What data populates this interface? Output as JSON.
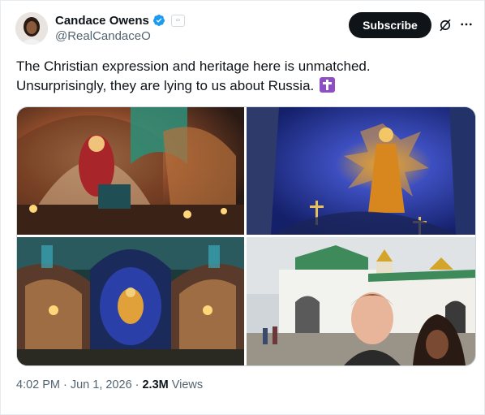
{
  "author": {
    "name": "Candace Owens",
    "handle": "@RealCandaceO",
    "verified_color": "#1d9bf0"
  },
  "header": {
    "subscribe_label": "Subscribe",
    "grok_icon": "grok-icon",
    "more_icon": "more-icon"
  },
  "tweet": {
    "line1": "The Christian expression and heritage here is unmatched.",
    "line2": "Unsurprisingly, they are lying to us about Russia.",
    "emoji": "cross-emoji"
  },
  "media": {
    "photos": [
      {
        "name": "cathedral-mosaic-madonna-photo"
      },
      {
        "name": "cathedral-dome-christ-mosaic-photo"
      },
      {
        "name": "cathedral-nave-interior-photo"
      },
      {
        "name": "monastery-selfie-photo"
      }
    ]
  },
  "meta": {
    "time": "4:02 PM",
    "separator1": "·",
    "date": "Jun 1, 2026",
    "separator2": "·",
    "views_count": "2.3M",
    "views_label": "Views"
  },
  "colors": {
    "text": "#0f1419",
    "secondary": "#536471",
    "button_bg": "#0f1419",
    "border": "#cfd9de",
    "emoji_purple": "#8e4fc4"
  }
}
